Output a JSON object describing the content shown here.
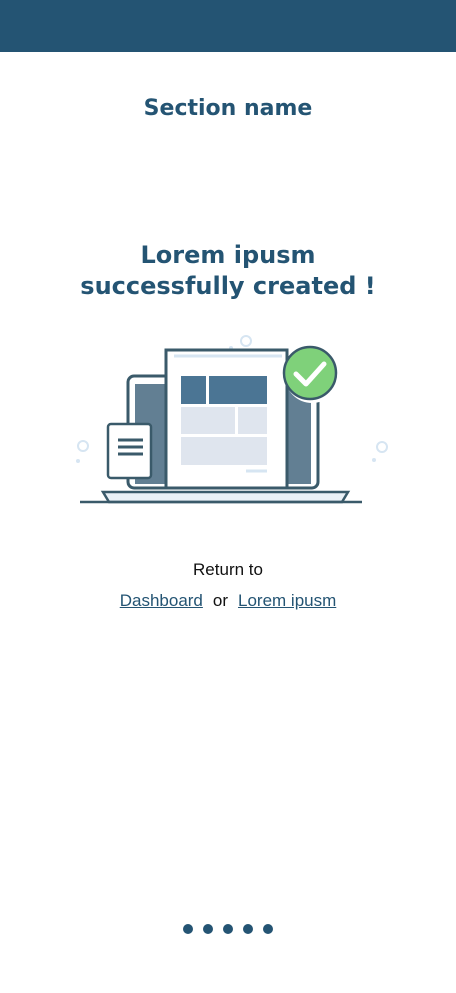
{
  "header": {
    "bar_color": "#245473"
  },
  "section": {
    "title": "Section name"
  },
  "message": {
    "line1": "Lorem ipusm",
    "line2": "successfully created !"
  },
  "illustration": {
    "icon": "laptop-success-icon",
    "check_color": "#7fd17a"
  },
  "navigation": {
    "return_to": "Return to",
    "dashboard_link": "Dashboard",
    "or": "or",
    "other_link": "Lorem ipusm"
  },
  "pagination": {
    "count": 5,
    "active_index": 0
  }
}
